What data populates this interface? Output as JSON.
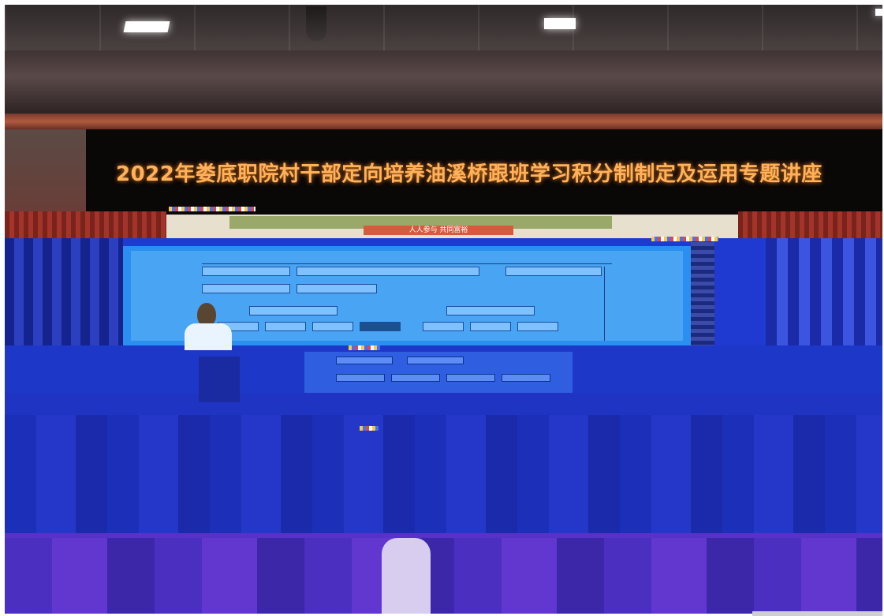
{
  "banner": {
    "text": "2022年娄底职院村干部定向培养油溪桥跟班学习积分制制定及运用专题讲座",
    "text_color": "#ffb25a"
  },
  "slide": {
    "header_red_text": "人人参与 共同富裕"
  },
  "colors": {
    "glitch_blue": "#1f3ad0",
    "glitch_purple": "#5732c8",
    "curtain_red": "#a3342a"
  }
}
